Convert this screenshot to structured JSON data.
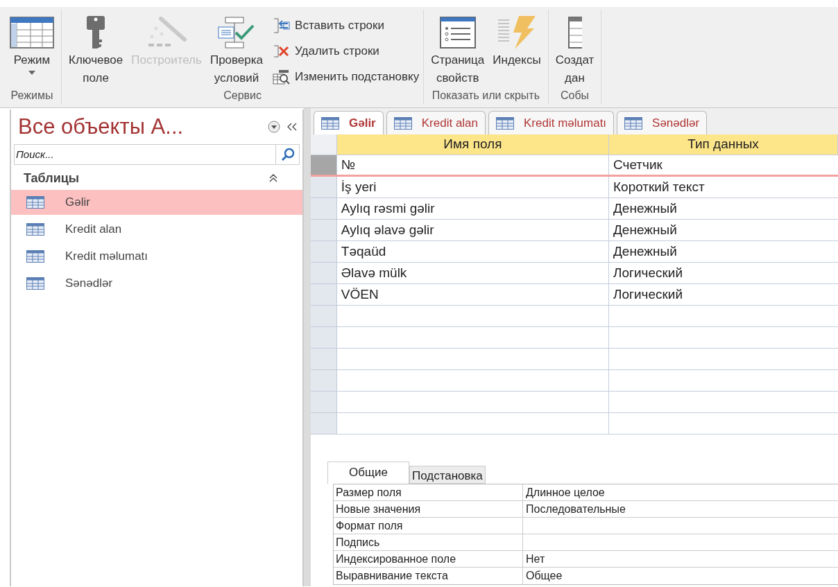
{
  "ribbon": {
    "groups": [
      {
        "label": "Режимы",
        "buttons": [
          {
            "kind": "large",
            "lines": [
              "Режим"
            ],
            "disabled": false,
            "dropdown": true
          }
        ]
      },
      {
        "label": "Сервис",
        "buttons": [
          {
            "kind": "large",
            "lines": [
              "Ключевое",
              "поле"
            ],
            "disabled": false,
            "dropdown": false
          },
          {
            "kind": "large",
            "lines": [
              "Построитель"
            ],
            "disabled": true,
            "dropdown": false
          },
          {
            "kind": "large",
            "lines": [
              "Проверка",
              "условий"
            ],
            "disabled": false,
            "dropdown": false
          },
          {
            "kind": "small",
            "lines": [
              "Вставить строки"
            ],
            "disabled": false,
            "dropdown": false
          },
          {
            "kind": "small",
            "lines": [
              "Удалить строки"
            ],
            "disabled": false,
            "dropdown": false
          },
          {
            "kind": "small",
            "lines": [
              "Изменить подстановку"
            ],
            "disabled": false,
            "dropdown": false
          }
        ]
      },
      {
        "label": "Показать или скрыть",
        "buttons": [
          {
            "kind": "large",
            "lines": [
              "Страница",
              "свойств"
            ],
            "disabled": false,
            "dropdown": false
          },
          {
            "kind": "large",
            "lines": [
              "Индексы"
            ],
            "disabled": false,
            "dropdown": false
          }
        ]
      },
      {
        "label": "Собы",
        "buttons": [
          {
            "kind": "large",
            "lines": [
              "Создат",
              "дан"
            ],
            "disabled": false,
            "dropdown": false
          }
        ]
      }
    ]
  },
  "nav": {
    "title": "Все объекты A...",
    "search": {
      "placeholder": "Поиск..."
    },
    "section": "Таблицы",
    "items": [
      {
        "label": "Gəlir",
        "selected": true
      },
      {
        "label": "Kredit alan",
        "selected": false
      },
      {
        "label": "Kredit məlumatı",
        "selected": false
      },
      {
        "label": "Sənədlər",
        "selected": false
      }
    ]
  },
  "tabs": [
    {
      "label": "Gəlir",
      "selected": true
    },
    {
      "label": "Kredit alan",
      "selected": false
    },
    {
      "label": "Kredit məlumatı",
      "selected": false
    },
    {
      "label": "Sənədlər",
      "selected": false
    }
  ],
  "table": {
    "columns": [
      "Имя поля",
      "Тип данных"
    ],
    "rows": [
      {
        "name": "№",
        "type": "Счетчик",
        "selected": true
      },
      {
        "name": "İş yeri",
        "type": "Короткий текст",
        "selected": false
      },
      {
        "name": "Aylıq rəsmi gəlir",
        "type": "Денежный",
        "selected": false
      },
      {
        "name": "Aylıq əlavə gəlir",
        "type": "Денежный",
        "selected": false
      },
      {
        "name": "Təqaüd",
        "type": "Денежный",
        "selected": false
      },
      {
        "name": "Əlavə mülk",
        "type": "Логический",
        "selected": false
      },
      {
        "name": "VÖEN",
        "type": "Логический",
        "selected": false
      }
    ]
  },
  "properties": {
    "tabs": [
      {
        "label": "Общие",
        "selected": true
      },
      {
        "label": "Подстановка",
        "selected": false
      }
    ],
    "rows": [
      {
        "label": "Размер поля",
        "value": "Длинное целое"
      },
      {
        "label": "Новые значения",
        "value": "Последовательные"
      },
      {
        "label": "Формат поля"
      },
      {
        "label": "Подпись"
      },
      {
        "label": "Индексированное поле",
        "value": "Нет"
      },
      {
        "label": "Выравнивание текста",
        "value": "Общее"
      }
    ]
  }
}
